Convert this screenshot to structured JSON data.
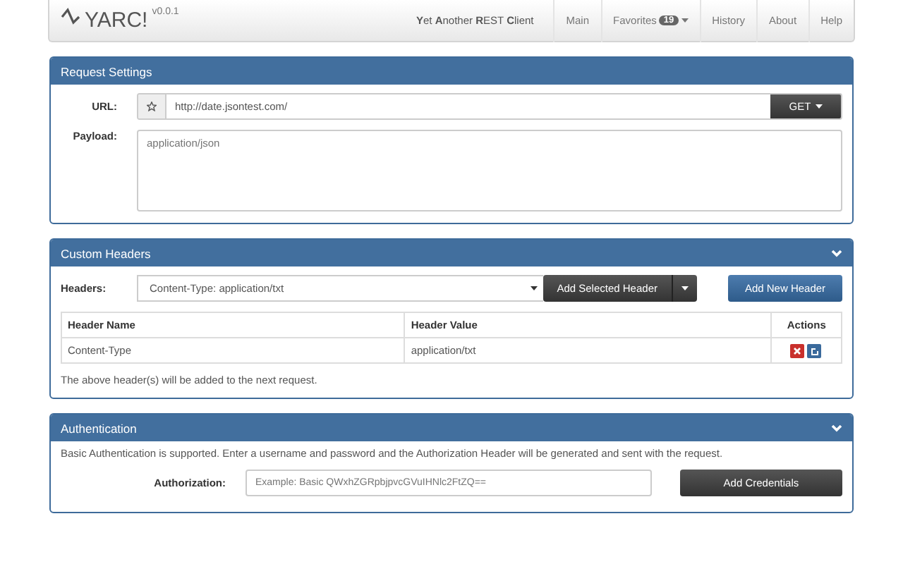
{
  "navbar": {
    "logo": "YARC!",
    "version": "v0.0.1",
    "tagline": "**Y**et **A**nother **R**EST **C**lient",
    "items": [
      {
        "label": "Main",
        "caret": false
      },
      {
        "label": "Favorites",
        "badge": "19",
        "caret": true
      },
      {
        "label": "History",
        "caret": false
      },
      {
        "label": "About",
        "caret": false
      },
      {
        "label": "Help",
        "caret": false
      }
    ]
  },
  "request_settings": {
    "title": "Request Settings",
    "url_label": "URL:",
    "url": "http://date.jsontest.com/",
    "method": "GET",
    "payload_label": "Payload:",
    "payload_placeholder": "application/json"
  },
  "custom_headers": {
    "title": "Custom Headers",
    "headers_label": "Headers:",
    "selected_header": "Content-Type: application/txt",
    "add_selected": "Add Selected Header",
    "add_new": "Add New Header",
    "table": {
      "columns": [
        "Header Name",
        "Header Value",
        "Actions"
      ],
      "rows": [
        {
          "name": "Content-Type",
          "value": "application/txt"
        }
      ]
    },
    "note": "The above header(s) will be added to the next request."
  },
  "authentication": {
    "title": "Authentication",
    "description": "Basic Authentication is supported. Enter a username and password and the Authorization Header will be generated and sent with the request.",
    "auth_label": "Authorization:",
    "auth_placeholder": "Example: Basic QWxhZGRpbjpvcGVuIHNlc2FtZQ==",
    "add_credentials": "Add Credentials"
  }
}
